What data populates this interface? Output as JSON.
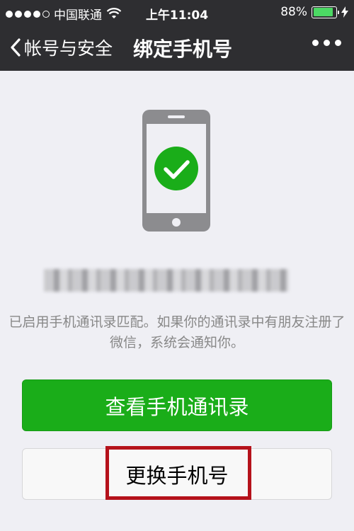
{
  "statusbar": {
    "carrier": "中国联通",
    "time": "上午11:04",
    "battery_text": "88%",
    "battery_level": 0.88,
    "signal_icon": "signal-dots-icon",
    "wifi_icon": "wifi-icon",
    "charging_icon": "charging-bolt-icon"
  },
  "navbar": {
    "back_label": "帐号与安全",
    "title": "绑定手机号",
    "more_icon": "more-dots-icon"
  },
  "main": {
    "illustration_icon": "phone-check-icon",
    "description": "已启用手机通讯录匹配。如果你的通讯录中有朋友注册了微信，系统会通知你。",
    "primary_button": "查看手机通讯录",
    "secondary_button": "更换手机号"
  },
  "colors": {
    "accent_green": "#1aad19",
    "nav_background": "#2e2e31",
    "highlight_red": "#b5121b"
  }
}
